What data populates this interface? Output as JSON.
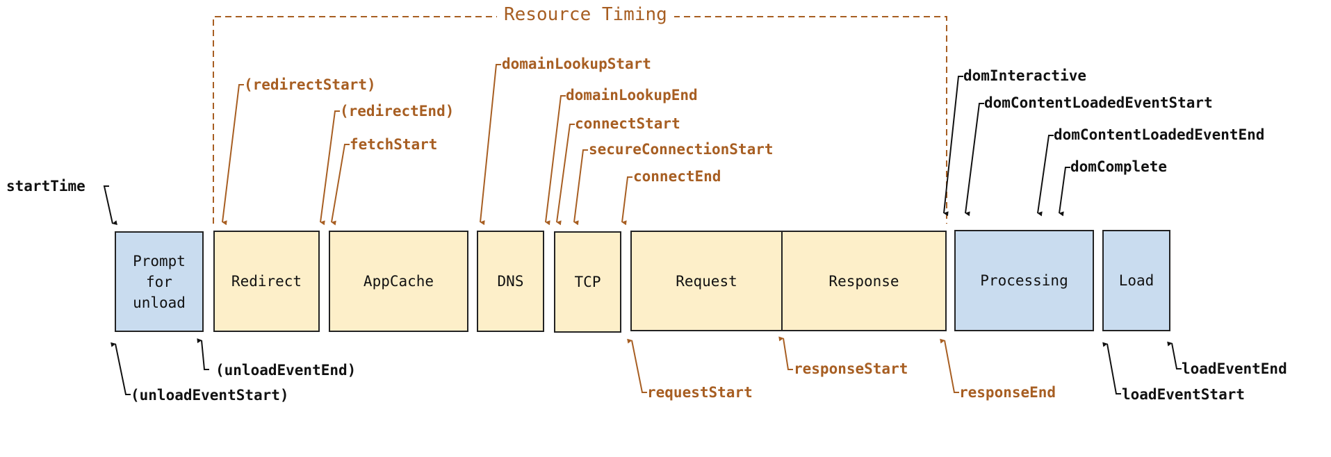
{
  "diagram": {
    "title": "Resource Timing",
    "colors": {
      "resource_accent": "#a75e22",
      "navigation_text": "#111111",
      "resource_box_fill": "#fdefc9",
      "navigation_box_fill": "#c9dcef",
      "box_border": "#222222"
    },
    "phases": [
      {
        "id": "prompt-for-unload",
        "label": "Prompt\nfor\nunload",
        "group": "navigation"
      },
      {
        "id": "redirect",
        "label": "Redirect",
        "group": "resource"
      },
      {
        "id": "appcache",
        "label": "AppCache",
        "group": "resource"
      },
      {
        "id": "dns",
        "label": "DNS",
        "group": "resource"
      },
      {
        "id": "tcp",
        "label": "TCP",
        "group": "resource"
      },
      {
        "id": "request",
        "label": "Request",
        "group": "resource"
      },
      {
        "id": "response",
        "label": "Response",
        "group": "resource"
      },
      {
        "id": "processing",
        "label": "Processing",
        "group": "navigation"
      },
      {
        "id": "load",
        "label": "Load",
        "group": "navigation"
      }
    ],
    "markers_top": [
      {
        "label": "startTime",
        "group": "navigation"
      },
      {
        "label": "(redirectStart)",
        "group": "resource"
      },
      {
        "label": "(redirectEnd)",
        "group": "resource"
      },
      {
        "label": "fetchStart",
        "group": "resource"
      },
      {
        "label": "domainLookupStart",
        "group": "resource"
      },
      {
        "label": "domainLookupEnd",
        "group": "resource"
      },
      {
        "label": "connectStart",
        "group": "resource"
      },
      {
        "label": "secureConnectionStart",
        "group": "resource"
      },
      {
        "label": "connectEnd",
        "group": "resource"
      },
      {
        "label": "domInteractive",
        "group": "navigation"
      },
      {
        "label": "domContentLoadedEventStart",
        "group": "navigation"
      },
      {
        "label": "domContentLoadedEventEnd",
        "group": "navigation"
      },
      {
        "label": "domComplete",
        "group": "navigation"
      }
    ],
    "markers_bottom": [
      {
        "label": "(unloadEventStart)",
        "group": "navigation"
      },
      {
        "label": "(unloadEventEnd)",
        "group": "navigation"
      },
      {
        "label": "requestStart",
        "group": "resource"
      },
      {
        "label": "responseStart",
        "group": "resource"
      },
      {
        "label": "responseEnd",
        "group": "resource"
      },
      {
        "label": "loadEventStart",
        "group": "navigation"
      },
      {
        "label": "loadEventEnd",
        "group": "navigation"
      }
    ]
  }
}
